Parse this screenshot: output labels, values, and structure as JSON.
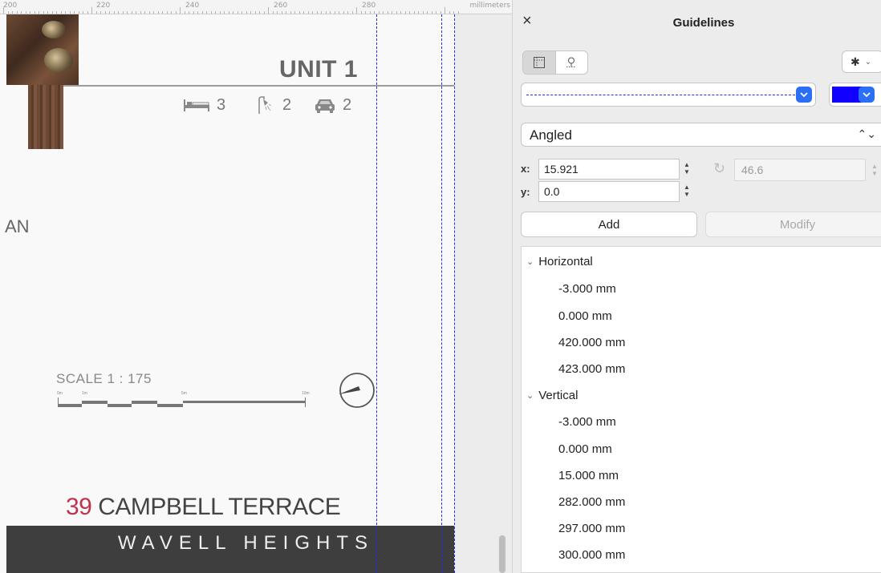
{
  "ruler": {
    "labels": [
      "200",
      "220",
      "240",
      "260",
      "280"
    ],
    "units": "millimeters"
  },
  "canvas": {
    "unit_title": "UNIT 1",
    "amenities": [
      {
        "icon": "bed-icon",
        "count": "3"
      },
      {
        "icon": "shower-icon",
        "count": "2"
      },
      {
        "icon": "car-icon",
        "count": "2"
      }
    ],
    "plan_text_fragment": "AN",
    "scale": {
      "label": "SCALE  1 : 175",
      "ticks": [
        "0m",
        "1m",
        "5m",
        "10m"
      ]
    },
    "address_number": "39",
    "address_street": " CAMPBELL TERRACE",
    "suburb": "WAVELL HEIGHTS"
  },
  "panel": {
    "close": "×",
    "title": "Guidelines",
    "line_color": "#1100ff",
    "type_value": "Angled",
    "x_label": "x:",
    "x_value": "15.921",
    "y_label": "y:",
    "y_value": "0.0",
    "angle_value": "46.6",
    "add_label": "Add",
    "modify_label": "Modify",
    "groups": [
      {
        "name": "Horizontal",
        "items": [
          "-3.000 mm",
          "0.000 mm",
          "420.000 mm",
          "423.000 mm"
        ]
      },
      {
        "name": "Vertical",
        "items": [
          "-3.000 mm",
          "0.000 mm",
          "15.000 mm",
          "282.000 mm",
          "297.000 mm",
          "300.000 mm"
        ]
      }
    ]
  }
}
